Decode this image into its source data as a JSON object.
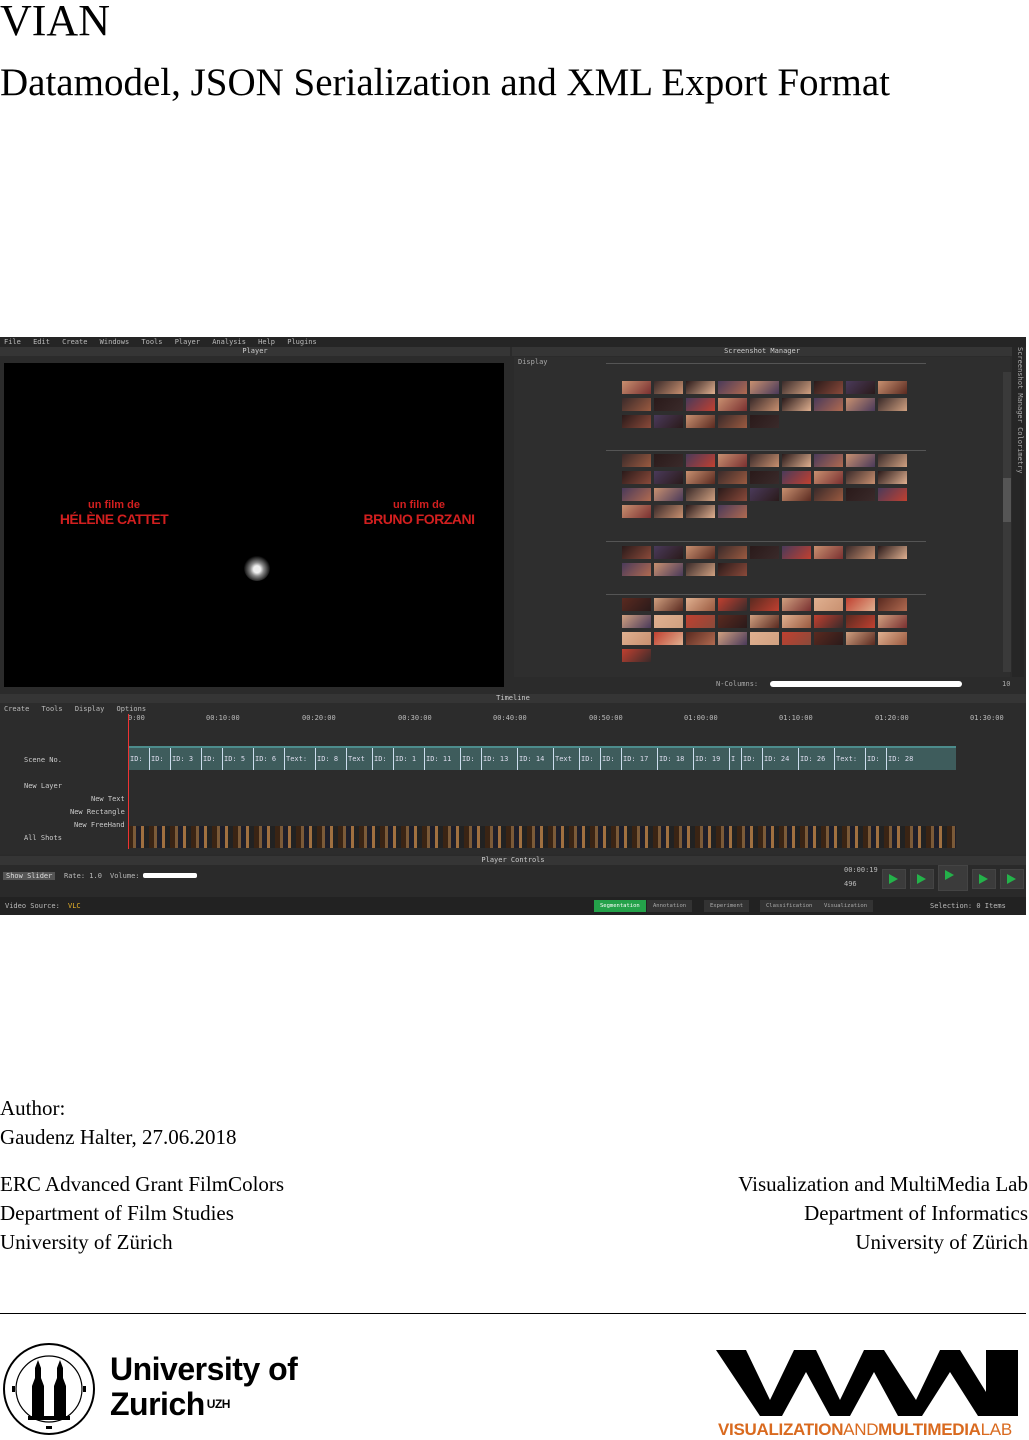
{
  "document": {
    "title": "VIAN",
    "subtitle": "Datamodel, JSON Serialization and XML Export Format",
    "author_label": "Author:",
    "author_line": "Gaudenz Halter, 27.06.2018",
    "left_affiliation": [
      "ERC Advanced Grant FilmColors",
      "Department of Film Studies",
      "University of Zürich"
    ],
    "right_affiliation": [
      "Visualization and MultiMedia Lab",
      "Department of Informatics",
      "University of Zürich"
    ]
  },
  "logos": {
    "uzh_line1": "University of",
    "uzh_line2": "Zurich",
    "uzh_sup": "UZH",
    "vmml_bold1": "VISUALIZATION",
    "vmml_thin": "AND",
    "vmml_bold2": "MULTIMEDIA",
    "vmml_thin2": "LAB"
  },
  "screenshot": {
    "menu": [
      "File",
      "Edit",
      "Create",
      "Windows",
      "Tools",
      "Player",
      "Analysis",
      "Help",
      "Plugins"
    ],
    "player_title": "Player",
    "screenshot_manager_title": "Screenshot Manager",
    "display_label": "Display",
    "side_tab": "Screenshot Manager  Colorimetry",
    "credit_left_small": "un film de",
    "credit_left_big": "HÉLÈNE CATTET",
    "credit_right_small": "un film de",
    "credit_right_big": "BRUNO FORZANI",
    "n_columns_label": "N-Columns:",
    "n_columns_value": "10",
    "timeline_title": "Timeline",
    "timeline_menu": [
      "Create",
      "Tools",
      "Display",
      "Options"
    ],
    "ruler_ticks": [
      "0:00",
      "00:10:00",
      "00:20:00",
      "00:30:00",
      "00:40:00",
      "00:50:00",
      "01:00:00",
      "01:10:00",
      "01:20:00",
      "01:30:00"
    ],
    "tracks": {
      "scene": "Scene No.",
      "layer": "New Layer",
      "text": "New Text",
      "rect": "New Rectangle",
      "free": "New FreeHand",
      "shots": "All Shots"
    },
    "scene_labels": [
      "ID:",
      "ID:",
      "ID: 3",
      "ID:",
      "ID: 5",
      "ID: 6",
      "Text:",
      "ID: 8",
      "Text",
      "ID:",
      "ID: 1",
      "ID: 11",
      "ID:",
      "ID: 13",
      "ID: 14",
      "Text",
      "ID:",
      "ID:",
      "ID: 17",
      "ID: 18",
      "ID: 19",
      "I",
      "ID:",
      "ID: 24",
      "ID: 26",
      "Text:",
      "ID:",
      "ID: 28"
    ],
    "player_controls_title": "Player Controls",
    "show_slider": "Show Slider",
    "rate": "Rate: 1.0",
    "volume": "Volume:",
    "time": "00:00:19",
    "frame": "496",
    "video_source_label": "Video Source:",
    "video_source_value": "VLC",
    "stages": [
      "Segmentation",
      "Annotation",
      "Experiment",
      "Classification",
      "Visualization"
    ],
    "selection": "Selection:  0 Items"
  }
}
